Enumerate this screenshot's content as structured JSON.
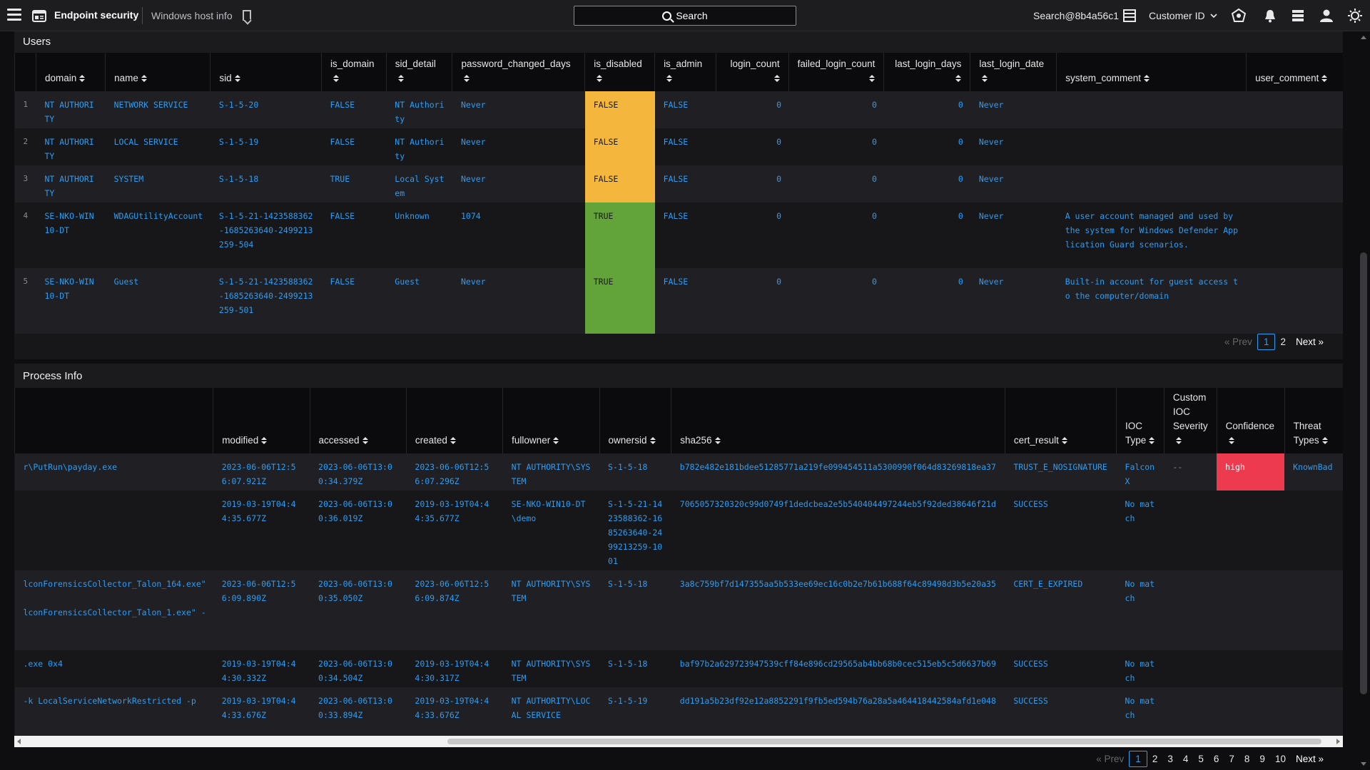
{
  "topbar": {
    "app_title": "Endpoint security",
    "breadcrumb": "Windows host info",
    "search_label": "Search",
    "user": "Search@8b4a56c1",
    "customer_label": "Customer ID"
  },
  "users": {
    "title": "Users",
    "columns": [
      "domain",
      "name",
      "sid",
      "is_domain",
      "sid_detail",
      "password_changed_days",
      "is_disabled",
      "is_admin",
      "login_count",
      "failed_login_count",
      "last_login_days",
      "last_login_date",
      "system_comment",
      "user_comment"
    ],
    "rows": [
      {
        "idx": "1",
        "domain": "NT AUTHORITY",
        "name": "NETWORK SERVICE",
        "sid": "S-1-5-20",
        "is_domain": "FALSE",
        "sid_detail": "NT Authority",
        "password_changed_days": "Never",
        "is_disabled": "FALSE",
        "is_admin": "FALSE",
        "login_count": "0",
        "failed_login_count": "0",
        "last_login_days": "0",
        "last_login_date": "Never",
        "system_comment": "",
        "user_comment": ""
      },
      {
        "idx": "2",
        "domain": "NT AUTHORITY",
        "name": "LOCAL SERVICE",
        "sid": "S-1-5-19",
        "is_domain": "FALSE",
        "sid_detail": "NT Authority",
        "password_changed_days": "Never",
        "is_disabled": "FALSE",
        "is_admin": "FALSE",
        "login_count": "0",
        "failed_login_count": "0",
        "last_login_days": "0",
        "last_login_date": "Never",
        "system_comment": "",
        "user_comment": ""
      },
      {
        "idx": "3",
        "domain": "NT AUTHORITY",
        "name": "SYSTEM",
        "sid": "S-1-5-18",
        "is_domain": "TRUE",
        "sid_detail": "Local System",
        "password_changed_days": "Never",
        "is_disabled": "FALSE",
        "is_admin": "FALSE",
        "login_count": "0",
        "failed_login_count": "0",
        "last_login_days": "0",
        "last_login_date": "Never",
        "system_comment": "",
        "user_comment": ""
      },
      {
        "idx": "4",
        "domain": "SE-NKO-WIN10-DT",
        "name": "WDAGUtilityAccount",
        "sid": "S-1-5-21-1423588362-1685263640-2499213259-504",
        "is_domain": "FALSE",
        "sid_detail": "Unknown",
        "password_changed_days": "1074",
        "is_disabled": "TRUE",
        "is_admin": "FALSE",
        "login_count": "0",
        "failed_login_count": "0",
        "last_login_days": "0",
        "last_login_date": "Never",
        "system_comment": "A user account managed and used by the system for Windows Defender Application Guard scenarios.",
        "user_comment": ""
      },
      {
        "idx": "5",
        "domain": "SE-NKO-WIN10-DT",
        "name": "Guest",
        "sid": "S-1-5-21-1423588362-1685263640-2499213259-501",
        "is_domain": "FALSE",
        "sid_detail": "Guest",
        "password_changed_days": "Never",
        "is_disabled": "TRUE",
        "is_admin": "FALSE",
        "login_count": "0",
        "failed_login_count": "0",
        "last_login_days": "0",
        "last_login_date": "Never",
        "system_comment": "Built-in account for guest access to the computer/domain",
        "user_comment": ""
      }
    ],
    "pager": {
      "prev": "« Prev",
      "pages": [
        "1",
        "2"
      ],
      "current": "1",
      "next": "Next »"
    }
  },
  "process": {
    "title": "Process Info",
    "columns": [
      "",
      "modified",
      "accessed",
      "created",
      "fullowner",
      "ownersid",
      "sha256",
      "cert_result",
      "IOC Type",
      "Custom IOC Severity",
      "Confidence",
      "Threat Types"
    ],
    "rows": [
      {
        "cmd": "r\\PutRun\\payday.exe",
        "cmd2": "",
        "modified": "2023-06-06T12:56:07.921Z",
        "accessed": "2023-06-06T13:00:34.379Z",
        "created": "2023-06-06T12:56:07.296Z",
        "fullowner": "NT AUTHORITY\\SYSTEM",
        "ownersid": "S-1-5-18",
        "sha256": "b782e482e181bdee51285771a219fe099454511a5300990f064d83269818ea37",
        "cert_result": "TRUST_E_NOSIGNATURE",
        "ioc_type": "Falcon X",
        "severity": "--",
        "confidence": "high",
        "threat_types": "KnownBad"
      },
      {
        "cmd": "",
        "cmd2": "",
        "modified": "2019-03-19T04:44:35.677Z",
        "accessed": "2023-06-06T13:00:36.019Z",
        "created": "2019-03-19T04:44:35.677Z",
        "fullowner": "SE-NKO-WIN10-DT\\demo",
        "ownersid": "S-1-5-21-1423588362-1685263640-2499213259-1001",
        "sha256": "7065057320320c99d0749f1dedcbea2e5b540404497244eb5f92ded38646f21d",
        "cert_result": "SUCCESS",
        "ioc_type": "No match",
        "severity": "",
        "confidence": "",
        "threat_types": ""
      },
      {
        "cmd": "lconForensicsCollector_Talon_164.exe\"",
        "cmd2": "lconForensicsCollector_Talon_1.exe\" -",
        "modified": "2023-06-06T12:56:09.890Z",
        "accessed": "2023-06-06T13:00:35.050Z",
        "created": "2023-06-06T12:56:09.874Z",
        "fullowner": "NT AUTHORITY\\SYSTEM",
        "ownersid": "S-1-5-18",
        "sha256": "3a8c759bf7d147355aa5b533ee69ec16c0b2e7b61b688f64c89498d3b5e20a35",
        "cert_result": "CERT_E_EXPIRED",
        "ioc_type": "No match",
        "severity": "",
        "confidence": "",
        "threat_types": ""
      },
      {
        "cmd": ".exe 0x4",
        "cmd2": "",
        "modified": "2019-03-19T04:44:30.332Z",
        "accessed": "2023-06-06T13:00:34.504Z",
        "created": "2019-03-19T04:44:30.317Z",
        "fullowner": "NT AUTHORITY\\SYSTEM",
        "ownersid": "S-1-5-18",
        "sha256": "baf97b2a629723947539cff84e896cd29565ab4bb68b0cec515eb5c5d6637b69",
        "cert_result": "SUCCESS",
        "ioc_type": "No match",
        "severity": "",
        "confidence": "",
        "threat_types": ""
      },
      {
        "cmd": "-k LocalServiceNetworkRestricted -p",
        "cmd2": "",
        "modified": "2019-03-19T04:44:33.676Z",
        "accessed": "2023-06-06T13:00:33.894Z",
        "created": "2019-03-19T04:44:33.676Z",
        "fullowner": "NT AUTHORITY\\LOCAL SERVICE",
        "ownersid": "S-1-5-19",
        "sha256": "dd191a5b23df92e12a8852291f9fb5ed594b76a28a5a464418442584afd1e048",
        "cert_result": "SUCCESS",
        "ioc_type": "No match",
        "severity": "",
        "confidence": "",
        "threat_types": ""
      }
    ],
    "pager": {
      "prev": "« Prev",
      "pages": [
        "1",
        "2",
        "3",
        "4",
        "5",
        "6",
        "7",
        "8",
        "9",
        "10"
      ],
      "current": "1",
      "next": "Next »"
    }
  },
  "colors": {
    "disabled_false": "#f4b63c",
    "disabled_true": "#63a43a",
    "confidence_high": "#ee3a4f",
    "link": "#2e9cf0"
  }
}
